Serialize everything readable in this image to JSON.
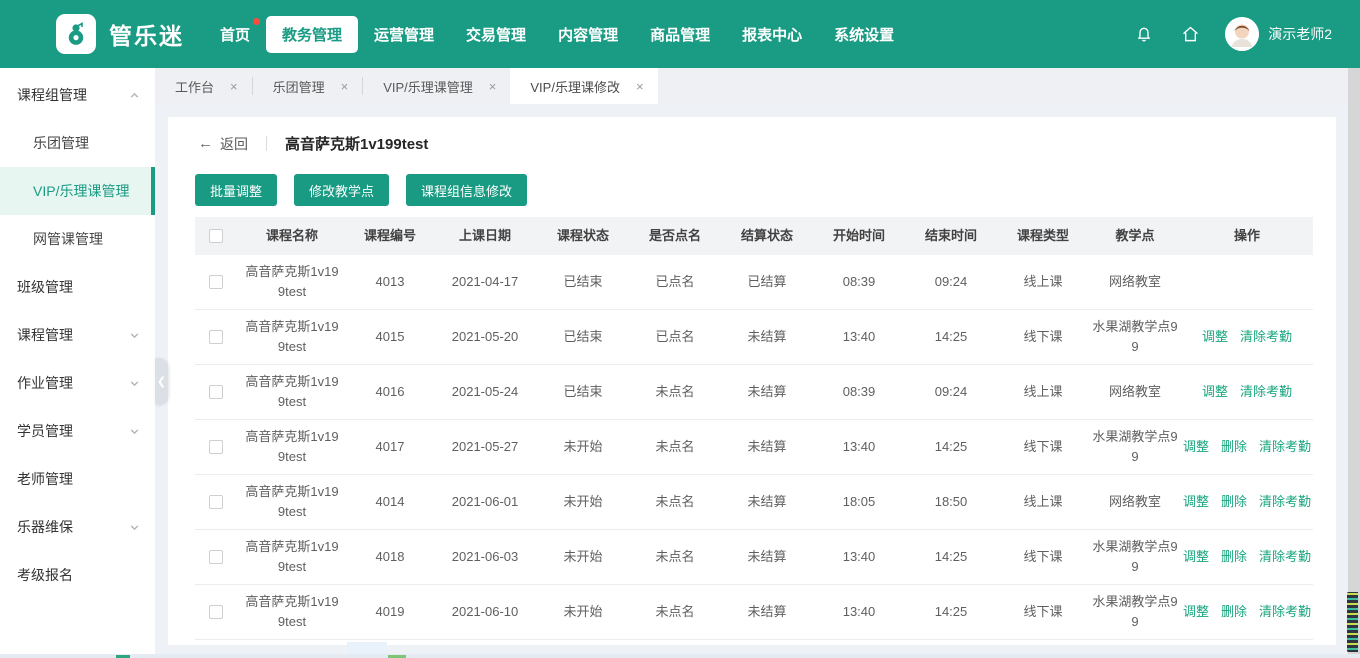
{
  "colors": {
    "accent": "#1a9b84",
    "link": "#18a57e",
    "badge": "#fa4b41"
  },
  "brand": {
    "name": "管乐迷"
  },
  "navbar": {
    "items": [
      {
        "label": "首页",
        "active": false,
        "badge": true
      },
      {
        "label": "教务管理",
        "active": true,
        "badge": false
      },
      {
        "label": "运营管理",
        "active": false,
        "badge": false
      },
      {
        "label": "交易管理",
        "active": false,
        "badge": false
      },
      {
        "label": "内容管理",
        "active": false,
        "badge": false
      },
      {
        "label": "商品管理",
        "active": false,
        "badge": false
      },
      {
        "label": "报表中心",
        "active": false,
        "badge": false
      },
      {
        "label": "系统设置",
        "active": false,
        "badge": false
      }
    ],
    "user": {
      "name": "演示老师2"
    }
  },
  "sidebar": {
    "items": [
      {
        "label": "课程组管理",
        "caret": "up",
        "children": [
          {
            "label": "乐团管理",
            "active": false
          },
          {
            "label": "VIP/乐理课管理",
            "active": true
          },
          {
            "label": "网管课管理",
            "active": false
          }
        ]
      },
      {
        "label": "班级管理"
      },
      {
        "label": "课程管理",
        "caret": "down"
      },
      {
        "label": "作业管理",
        "caret": "down"
      },
      {
        "label": "学员管理",
        "caret": "down"
      },
      {
        "label": "老师管理"
      },
      {
        "label": "乐器维保",
        "caret": "down"
      },
      {
        "label": "考级报名"
      }
    ]
  },
  "tabs": [
    {
      "label": "工作台",
      "active": false
    },
    {
      "label": "乐团管理",
      "active": false
    },
    {
      "label": "VIP/乐理课管理",
      "active": false
    },
    {
      "label": "VIP/乐理课修改",
      "active": true
    }
  ],
  "page": {
    "back_label": "返回",
    "title": "高音萨克斯1v199test",
    "buttons": [
      "批量调整",
      "修改教学点",
      "课程组信息修改"
    ]
  },
  "table": {
    "columns": [
      "课程名称",
      "课程编号",
      "上课日期",
      "课程状态",
      "是否点名",
      "结算状态",
      "开始时间",
      "结束时间",
      "课程类型",
      "教学点",
      "操作"
    ],
    "rows": [
      {
        "name": "高音萨克斯1v199test",
        "code": "4013",
        "date": "2021-04-17",
        "status": "已结束",
        "rollcall": "已点名",
        "settle": "已结算",
        "start": "08:39",
        "end": "09:24",
        "type": "线上课",
        "location": "网络教室",
        "actions": []
      },
      {
        "name": "高音萨克斯1v199test",
        "code": "4015",
        "date": "2021-05-20",
        "status": "已结束",
        "rollcall": "已点名",
        "settle": "未结算",
        "start": "13:40",
        "end": "14:25",
        "type": "线下课",
        "location": "水果湖教学点99",
        "actions": [
          "调整",
          "清除考勤"
        ]
      },
      {
        "name": "高音萨克斯1v199test",
        "code": "4016",
        "date": "2021-05-24",
        "status": "已结束",
        "rollcall": "未点名",
        "settle": "未结算",
        "start": "08:39",
        "end": "09:24",
        "type": "线上课",
        "location": "网络教室",
        "actions": [
          "调整",
          "清除考勤"
        ]
      },
      {
        "name": "高音萨克斯1v199test",
        "code": "4017",
        "date": "2021-05-27",
        "status": "未开始",
        "rollcall": "未点名",
        "settle": "未结算",
        "start": "13:40",
        "end": "14:25",
        "type": "线下课",
        "location": "水果湖教学点99",
        "actions": [
          "调整",
          "删除",
          "清除考勤"
        ]
      },
      {
        "name": "高音萨克斯1v199test",
        "code": "4014",
        "date": "2021-06-01",
        "status": "未开始",
        "rollcall": "未点名",
        "settle": "未结算",
        "start": "18:05",
        "end": "18:50",
        "type": "线上课",
        "location": "网络教室",
        "actions": [
          "调整",
          "删除",
          "清除考勤"
        ]
      },
      {
        "name": "高音萨克斯1v199test",
        "code": "4018",
        "date": "2021-06-03",
        "status": "未开始",
        "rollcall": "未点名",
        "settle": "未结算",
        "start": "13:40",
        "end": "14:25",
        "type": "线下课",
        "location": "水果湖教学点99",
        "actions": [
          "调整",
          "删除",
          "清除考勤"
        ]
      },
      {
        "name": "高音萨克斯1v199test",
        "code": "4019",
        "date": "2021-06-10",
        "status": "未开始",
        "rollcall": "未点名",
        "settle": "未结算",
        "start": "13:40",
        "end": "14:25",
        "type": "线下课",
        "location": "水果湖教学点99",
        "actions": [
          "调整",
          "删除",
          "清除考勤"
        ]
      }
    ]
  }
}
